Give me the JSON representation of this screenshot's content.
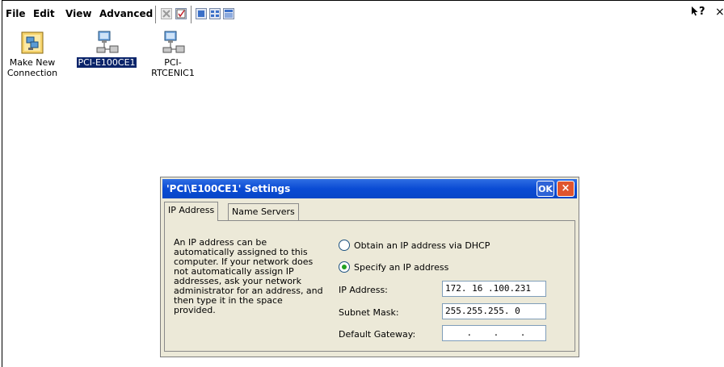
{
  "menu": {
    "file": "File",
    "edit": "Edit",
    "view": "View",
    "advanced": "Advanced",
    "help_glyph": "?",
    "close_glyph": "×"
  },
  "desktop": {
    "icons": [
      {
        "label_line1": "Make New",
        "label_line2": "Connection",
        "icon": "make-connection-icon"
      },
      {
        "label_line1": "PCI-E100CE1",
        "label_line2": "",
        "icon": "network-adapter-icon",
        "selected": true
      },
      {
        "label_line1": "PCI-",
        "label_line2": "RTCENIC1",
        "icon": "network-adapter-icon"
      }
    ]
  },
  "dialog": {
    "title": "'PCI\\E100CE1' Settings",
    "ok_label": "OK",
    "close_label": "×",
    "tabs": [
      "IP Address",
      "Name Servers"
    ],
    "description": "An IP address can be automatically assigned to this computer.  If your network does not automatically assign IP addresses, ask your network administrator for an address, and then type it in the space provided.",
    "radio_dhcp": "Obtain an IP address via DHCP",
    "radio_specify": "Specify an IP address",
    "ip_label": "IP Address:",
    "ip_value": "172. 16 .100.231",
    "subnet_label": "Subnet Mask:",
    "subnet_value": "255.255.255. 0",
    "gateway_label": "Default Gateway:",
    "gateway_value": "    .    .    .",
    "selected_radio": "specify"
  },
  "colors": {
    "titlebar": "#0a4bd4",
    "dialog_bg": "#ece9d8",
    "selection": "#0a246a",
    "radio_dot": "#21a121"
  }
}
